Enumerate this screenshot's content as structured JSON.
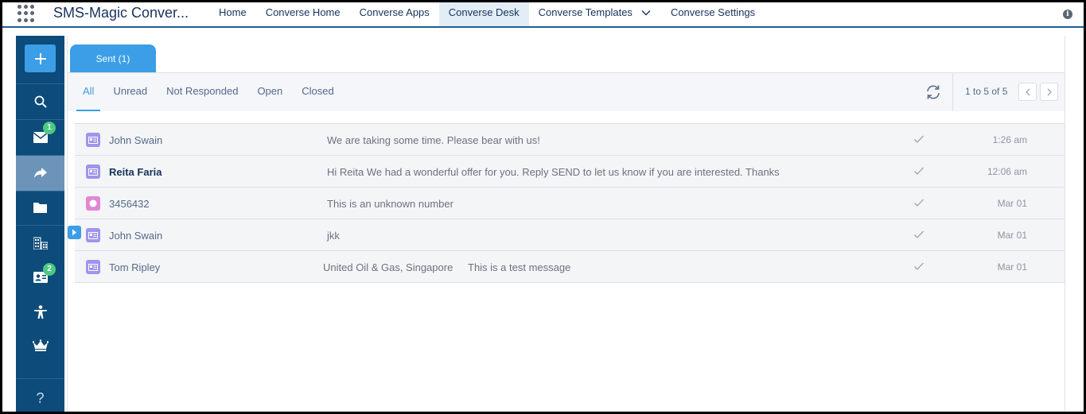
{
  "app": {
    "name": "SMS-Magic Conver..."
  },
  "nav": {
    "items": [
      {
        "label": "Home",
        "active": false
      },
      {
        "label": "Converse Home",
        "active": false
      },
      {
        "label": "Converse Apps",
        "active": false
      },
      {
        "label": "Converse Desk",
        "active": true
      },
      {
        "label": "Converse Templates",
        "active": false,
        "dropdown": true
      },
      {
        "label": "Converse Settings",
        "active": false
      }
    ],
    "info_icon": "i"
  },
  "rail": {
    "items": [
      {
        "icon": "search-icon"
      },
      {
        "icon": "envelope-icon",
        "badge": "1"
      },
      {
        "icon": "forward-arrow-icon",
        "active": true
      },
      {
        "icon": "folder-icon"
      },
      {
        "icon": "buildings-icon"
      },
      {
        "icon": "contact-card-icon",
        "badge": "2"
      },
      {
        "icon": "person-icon"
      },
      {
        "icon": "crown-icon"
      }
    ],
    "help_label": "?"
  },
  "tabs": {
    "sent_label": "Sent (1)"
  },
  "filters": {
    "tabs": [
      {
        "label": "All",
        "active": true
      },
      {
        "label": "Unread",
        "active": false
      },
      {
        "label": "Not Responded",
        "active": false
      },
      {
        "label": "Open",
        "active": false
      },
      {
        "label": "Closed",
        "active": false
      }
    ]
  },
  "pager": {
    "text": "1 to 5 of 5"
  },
  "messages": [
    {
      "name": "John Swain",
      "bold": false,
      "type": "contact",
      "message": "We are taking some time. Please bear with us!",
      "time": "1:26 am"
    },
    {
      "name": "Reita Faria",
      "bold": true,
      "type": "contact",
      "message": "Hi Reita We had a wonderful offer for you. Reply SEND to let us know if you are interested. Thanks",
      "time": "12:06 am"
    },
    {
      "name": "3456432",
      "bold": false,
      "type": "lead",
      "message": "This is an unknown number",
      "time": "Mar 01"
    },
    {
      "name": "John Swain",
      "bold": false,
      "type": "contact",
      "message": "jkk",
      "time": "Mar 01"
    },
    {
      "name": "Tom Ripley",
      "bold": false,
      "type": "contact",
      "company": "United Oil & Gas, Singapore",
      "message": "This is a test message",
      "time": "Mar 01"
    }
  ],
  "colors": {
    "nav_blue": "#1f5e91",
    "rail_bg": "#0d4b7a",
    "rail_active": "#6b94b8",
    "accent": "#3b9ee6",
    "badge_green": "#4bca81",
    "contact_purple": "#a094ed",
    "lead_pink": "#e287d4"
  }
}
